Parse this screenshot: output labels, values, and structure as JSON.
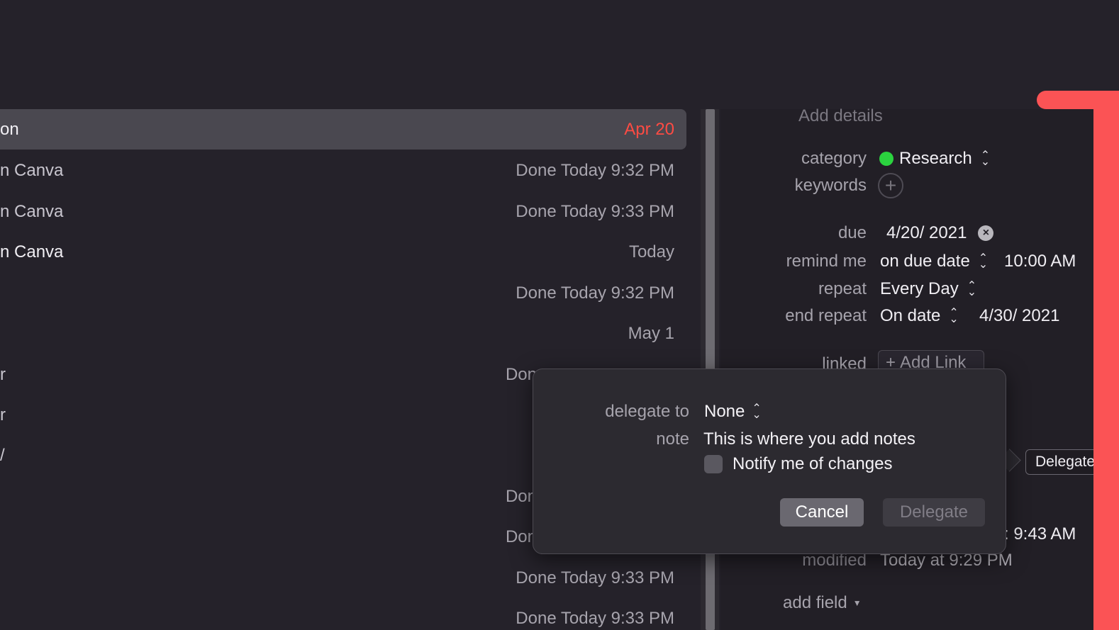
{
  "tasks": [
    {
      "title": "on",
      "date": "Apr 20"
    },
    {
      "title": "n Canva",
      "date": "Done Today 9:32 PM"
    },
    {
      "title": "n Canva",
      "date": "Done Today 9:33 PM"
    },
    {
      "title": "n Canva",
      "date": "Today"
    },
    {
      "title": "",
      "date": "Done Today 9:32 PM"
    },
    {
      "title": "",
      "date": "May 1"
    },
    {
      "title": "r",
      "date": "Don"
    },
    {
      "title": "r",
      "date": ""
    },
    {
      "title": "/",
      "date": ""
    },
    {
      "title": "",
      "date": "Don"
    },
    {
      "title": "",
      "date": "Don"
    },
    {
      "title": "",
      "date": "Done Today 9:33 PM"
    },
    {
      "title": "",
      "date": "Done Today 9:33 PM"
    }
  ],
  "details": {
    "add_details_placeholder": "Add details",
    "category_label": "category",
    "category_value": "Research",
    "keywords_label": "keywords",
    "due_label": "due",
    "due_value": "4/20/ 2021",
    "remind_label": "remind me",
    "remind_value": "on due date",
    "remind_time": "10:00 AM",
    "repeat_label": "repeat",
    "repeat_value": "Every Day",
    "end_repeat_label": "end repeat",
    "end_repeat_value": "On date",
    "end_repeat_date": "4/30/ 2021",
    "linked_label": "linked",
    "add_link_label": "Add Link",
    "created_partial": ": 9:43 AM",
    "modified_label": "modified",
    "modified_value": "Today at 9:29 PM",
    "add_field_label": "add field",
    "delegate_toolbar_label": "Delegate"
  },
  "popover": {
    "delegate_to_label": "delegate to",
    "delegate_to_value": "None",
    "note_label": "note",
    "note_value": "This is where you add notes",
    "notify_label": "Notify me of changes",
    "cancel_label": "Cancel",
    "delegate_label": "Delegate"
  },
  "colors": {
    "background": "#25222a",
    "accent_red": "#ff4b43",
    "category_green": "#2bd33f",
    "annotation_red": "#fb5355"
  }
}
